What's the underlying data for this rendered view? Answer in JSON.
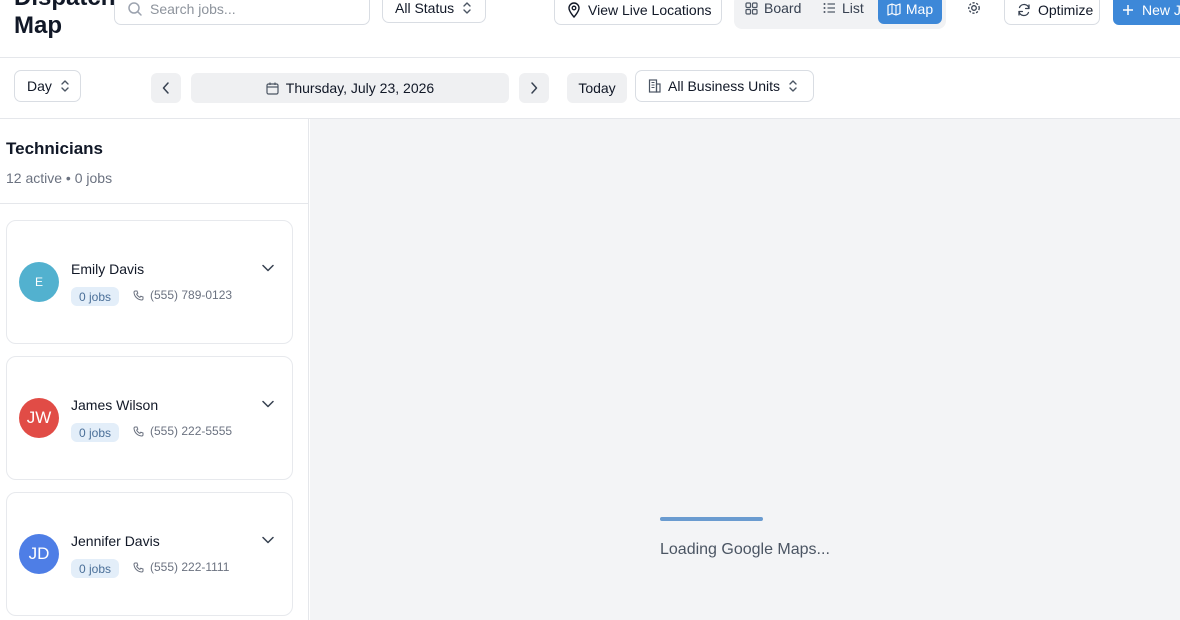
{
  "header": {
    "title_partial": "Dispatch",
    "title": "Map",
    "search_placeholder": "Search jobs...",
    "status_filter": "All Status",
    "view_live_label": "View Live Locations",
    "views": [
      {
        "label": "Board",
        "icon": "grid-icon",
        "active": false
      },
      {
        "label": "List",
        "icon": "list-icon",
        "active": false
      },
      {
        "label": "Map",
        "icon": "map-icon",
        "active": true
      }
    ],
    "optimize_label": "Optimize",
    "new_job_label": "New J"
  },
  "toolbar": {
    "range": "Day",
    "date": "Thursday, July 23, 2026",
    "today_label": "Today",
    "business_units": "All Business Units"
  },
  "sidebar": {
    "title": "Technicians",
    "summary": "12 active • 0 jobs",
    "technicians": [
      {
        "initials": "E",
        "name": "Emily Davis",
        "jobs": "0 jobs",
        "phone": "(555) 789-0123",
        "color": "#52b1cf"
      },
      {
        "initials": "JW",
        "name": "James Wilson",
        "jobs": "0 jobs",
        "phone": "(555) 222-5555",
        "color": "#e14c46"
      },
      {
        "initials": "JD",
        "name": "Jennifer Davis",
        "jobs": "0 jobs",
        "phone": "(555) 222-1111",
        "color": "#4e7ee6"
      }
    ]
  },
  "map": {
    "loading_text": "Loading Google Maps...",
    "loading_progress": 1.0
  },
  "colors": {
    "accent": "#3d88d8",
    "map_bg": "#f3f4f6",
    "badge_bg": "#e3eef9"
  }
}
